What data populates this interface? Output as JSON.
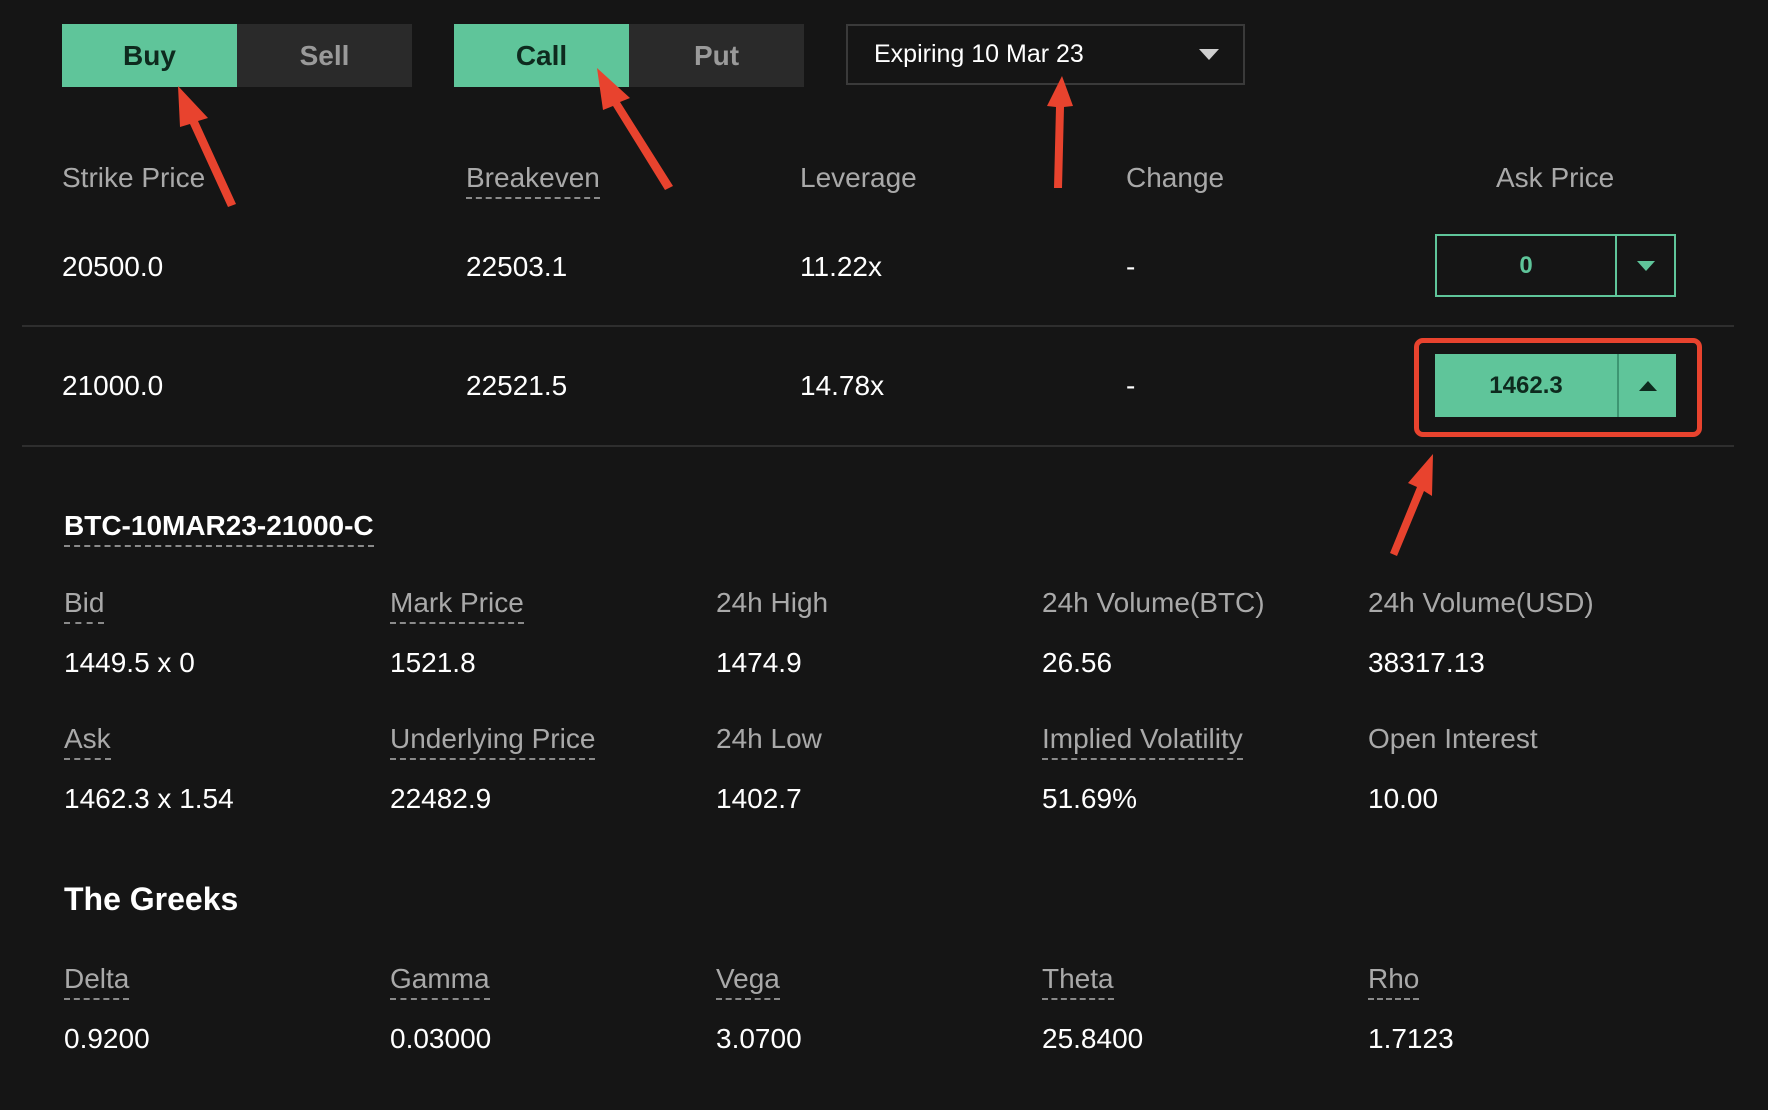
{
  "side_toggle": {
    "buy": "Buy",
    "sell": "Sell",
    "selected": "Buy"
  },
  "type_toggle": {
    "call": "Call",
    "put": "Put",
    "selected": "Call"
  },
  "expiry": {
    "label": "Expiring 10 Mar 23",
    "icon": "chevron-down-icon"
  },
  "table": {
    "headers": {
      "strike": "Strike Price",
      "breakeven": "Breakeven",
      "leverage": "Leverage",
      "change": "Change",
      "ask": "Ask Price"
    },
    "rows": [
      {
        "strike": "20500.0",
        "breakeven": "22503.1",
        "leverage": "11.22x",
        "change": "-",
        "ask": "0",
        "ask_state": "collapsed"
      },
      {
        "strike": "21000.0",
        "breakeven": "22521.5",
        "leverage": "14.78x",
        "change": "-",
        "ask": "1462.3",
        "ask_state": "expanded"
      }
    ]
  },
  "detail": {
    "instrument": "BTC-10MAR23-21000-C",
    "stats": {
      "bid_label": "Bid",
      "bid_value": "1449.5 x 0",
      "mark_label": "Mark Price",
      "mark_value": "1521.8",
      "high_label": "24h High",
      "high_value": "1474.9",
      "vol_btc_label": "24h Volume(BTC)",
      "vol_btc_value": "26.56",
      "vol_usd_label": "24h Volume(USD)",
      "vol_usd_value": "38317.13",
      "ask_label": "Ask",
      "ask_value": "1462.3 x 1.54",
      "underlying_label": "Underlying Price",
      "underlying_value": "22482.9",
      "low_label": "24h Low",
      "low_value": "1402.7",
      "iv_label": "Implied Volatility",
      "iv_value": "51.69%",
      "oi_label": "Open Interest",
      "oi_value": "10.00"
    }
  },
  "greeks": {
    "title": "The Greeks",
    "delta_label": "Delta",
    "delta_value": "0.9200",
    "gamma_label": "Gamma",
    "gamma_value": "0.03000",
    "vega_label": "Vega",
    "vega_value": "3.0700",
    "theta_label": "Theta",
    "theta_value": "25.8400",
    "rho_label": "Rho",
    "rho_value": "1.7123"
  },
  "colors": {
    "accent": "#5fc59a",
    "annotation": "#e8432e",
    "background": "#151515"
  }
}
